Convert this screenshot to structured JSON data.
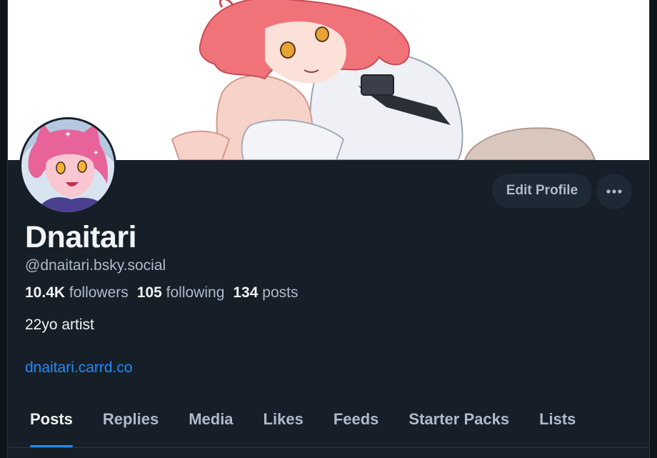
{
  "profile": {
    "display_name": "Dnaitari",
    "handle": "@dnaitari.bsky.social",
    "stats": {
      "followers_count": "10.4K",
      "followers_label": "followers",
      "following_count": "105",
      "following_label": "following",
      "posts_count": "134",
      "posts_label": "posts"
    },
    "bio": "22yo artist",
    "link": "dnaitari.carrd.co"
  },
  "actions": {
    "edit_profile_label": "Edit Profile",
    "more_icon": "ellipsis-icon"
  },
  "tabs": [
    {
      "label": "Posts",
      "active": true
    },
    {
      "label": "Replies",
      "active": false
    },
    {
      "label": "Media",
      "active": false
    },
    {
      "label": "Likes",
      "active": false
    },
    {
      "label": "Feeds",
      "active": false
    },
    {
      "label": "Starter Packs",
      "active": false
    },
    {
      "label": "Lists",
      "active": false
    }
  ],
  "colors": {
    "background": "#161e27",
    "accent": "#208bfe",
    "primary_text": "#f1f3f5",
    "secondary_text": "#aebbc9",
    "button_bg": "#1e2936"
  }
}
